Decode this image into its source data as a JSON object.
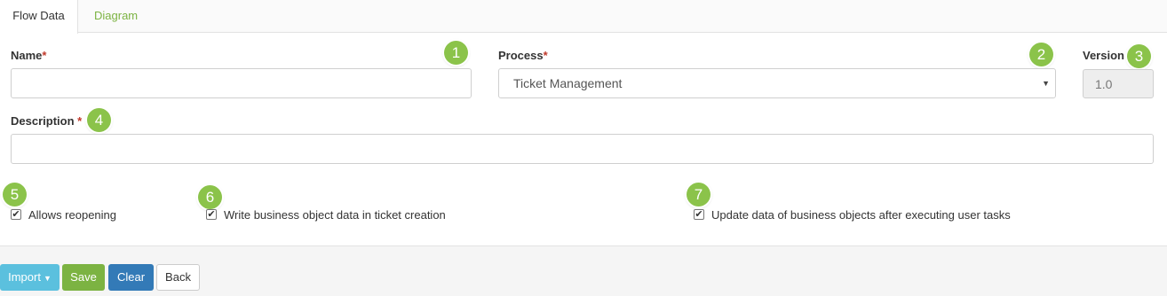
{
  "tabs": [
    {
      "label": "Flow Data",
      "active": true
    },
    {
      "label": "Diagram",
      "active": false
    }
  ],
  "form": {
    "name": {
      "label": "Name",
      "required_mark": "*",
      "value": ""
    },
    "process": {
      "label": "Process",
      "required_mark": "*",
      "value": "Ticket Management"
    },
    "version": {
      "label": "Version",
      "value": "1.0"
    },
    "description": {
      "label": "Description",
      "required_mark": "*",
      "value": ""
    }
  },
  "checkboxes": [
    {
      "label": "Allows reopening",
      "checked": true
    },
    {
      "label": "Write business object data in ticket creation",
      "checked": true
    },
    {
      "label": "Update data of business objects after executing user tasks",
      "checked": true
    }
  ],
  "badges": [
    "1",
    "2",
    "3",
    "4",
    "5",
    "6",
    "7"
  ],
  "footer": {
    "import_label": "Import",
    "save_label": "Save",
    "clear_label": "Clear",
    "back_label": "Back"
  },
  "colors": {
    "accent_green": "#8bc34a",
    "save_green": "#7cb342",
    "import_blue": "#5bc0de",
    "clear_blue": "#337ab7",
    "required_red": "#c0392b"
  }
}
